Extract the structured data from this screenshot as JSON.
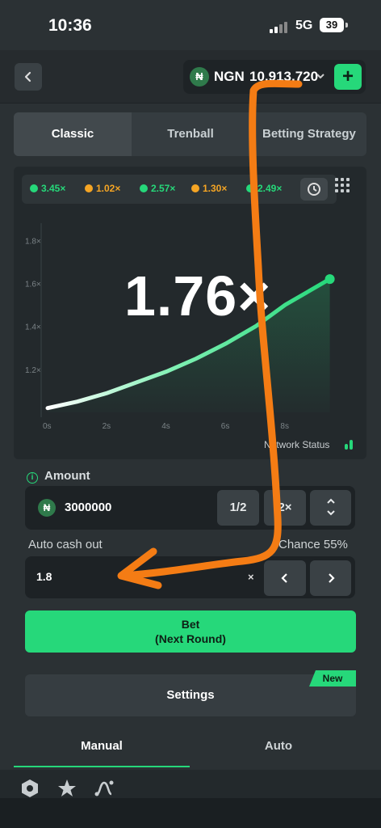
{
  "status_bar": {
    "time": "10:36",
    "network": "5G",
    "battery": "39"
  },
  "header": {
    "back_icon": "chevron-left-icon",
    "currency": "NGN",
    "currency_symbol": "₦",
    "balance": "10,913,720",
    "add_label": "+"
  },
  "mode_tabs": [
    "Classic",
    "Trenball",
    "Betting Strategy"
  ],
  "history": [
    {
      "value": "3.45×",
      "color": "#26d87a"
    },
    {
      "value": "1.02×",
      "color": "#f5a524"
    },
    {
      "value": "2.57×",
      "color": "#26d87a"
    },
    {
      "value": "1.30×",
      "color": "#f5a524"
    },
    {
      "value": "2.49×",
      "color": "#26d87a"
    }
  ],
  "game": {
    "multiplier": "1.76×",
    "network_status": "Network Status"
  },
  "chart_data": {
    "type": "line",
    "x": [
      0,
      1,
      2,
      3,
      4,
      5,
      6,
      7,
      8,
      9.5
    ],
    "y": [
      1.02,
      1.05,
      1.09,
      1.14,
      1.19,
      1.25,
      1.32,
      1.4,
      1.5,
      1.62
    ],
    "xticks": [
      "0s",
      "2s",
      "4s",
      "6s",
      "8s"
    ],
    "xtick_values": [
      0,
      2,
      4,
      6,
      8
    ],
    "yticks": [
      "1.2×",
      "1.4×",
      "1.6×",
      "1.8×"
    ],
    "ytick_values": [
      1.2,
      1.4,
      1.6,
      1.8
    ],
    "xlim": [
      0,
      10
    ],
    "ylim": [
      1.0,
      1.88
    ],
    "grid": false,
    "line_color": "#26d87a"
  },
  "bet": {
    "amount_label": "Amount",
    "amount_value": "3000000",
    "half_label": "1/2",
    "double_label": "2×",
    "auto_cash_label": "Auto cash out",
    "chance_label": "Chance 55%",
    "auto_cash_value": "1.8",
    "x_label": "×",
    "bet_line1": "Bet",
    "bet_line2": "(Next Round)",
    "settings_label": "Settings",
    "new_badge": "New"
  },
  "bottom_tabs": [
    "Manual",
    "Auto"
  ],
  "footer_icons": [
    "hexagon-icon",
    "star-icon",
    "graph-icon"
  ]
}
